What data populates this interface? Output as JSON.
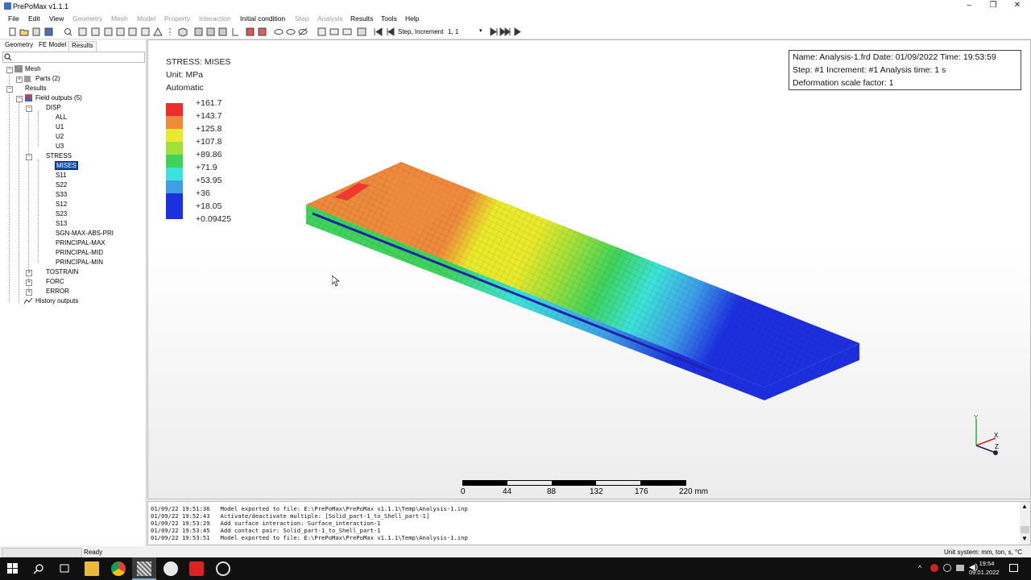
{
  "window": {
    "title": "PrePoMax v1.1.1",
    "controls": [
      "–",
      "❐",
      "✕"
    ]
  },
  "menu": [
    {
      "label": "File",
      "enabled": true
    },
    {
      "label": "Edit",
      "enabled": true
    },
    {
      "label": "View",
      "enabled": true
    },
    {
      "label": "Geometry",
      "enabled": false
    },
    {
      "label": "Mesh",
      "enabled": false
    },
    {
      "label": "Model",
      "enabled": false
    },
    {
      "label": "Property",
      "enabled": false
    },
    {
      "label": "Interaction",
      "enabled": false
    },
    {
      "label": "Initial condition",
      "enabled": true
    },
    {
      "label": "Step",
      "enabled": false
    },
    {
      "label": "Analysis",
      "enabled": false
    },
    {
      "label": "Results",
      "enabled": true
    },
    {
      "label": "Tools",
      "enabled": true
    },
    {
      "label": "Help",
      "enabled": true
    }
  ],
  "toolbar": {
    "step_increment_label": "Step, Increment",
    "step_increment_value": "1, 1"
  },
  "tabs": [
    "Geometry",
    "FE Model",
    "Results"
  ],
  "tree": {
    "mesh": "Mesh",
    "parts": "Parts (2)",
    "results": "Results",
    "field_outputs": "Field outputs (5)",
    "disp": "DISP",
    "disp_items": [
      "ALL",
      "U1",
      "U2",
      "U3"
    ],
    "stress": "STRESS",
    "stress_items": [
      "MISES",
      "S11",
      "S22",
      "S33",
      "S12",
      "S23",
      "S13",
      "SGN-MAX-ABS-PRI",
      "PRINCIPAL-MAX",
      "PRINCIPAL-MID",
      "PRINCIPAL-MIN"
    ],
    "others": [
      "TOSTRAIN",
      "FORC",
      "ERROR"
    ],
    "history_outputs": "History outputs"
  },
  "legend": {
    "title": "STRESS: MISES",
    "unit": "Unit: MPa",
    "mode": "Automatic",
    "colors": [
      "#ed2d2d",
      "#ee8a3c",
      "#eaea2c",
      "#9fe03a",
      "#3fd35c",
      "#3de3d8",
      "#3e9fe6",
      "#1d30e0"
    ],
    "values": [
      "+161.7",
      "+143.7",
      "+125.8",
      "+107.8",
      "+89.86",
      "+71.9",
      "+53.95",
      "+36",
      "+18.05",
      "+0.09425"
    ]
  },
  "info": {
    "line1": "Name: Analysis-1.frd   Date: 01/09/2022   Time: 19:53:59",
    "line2": "Step: #1   Increment: #1   Analysis time: 1 s",
    "line3": "Deformation scale factor: 1"
  },
  "scale_bar": {
    "labels": [
      "0",
      "44",
      "88",
      "132",
      "176",
      "220 mm"
    ]
  },
  "axes": {
    "y": "Y",
    "x": "X",
    "z": "Z"
  },
  "log": [
    "01/09/22 19:51:36   Model exported to file: E:\\PrePoMax\\PrePoMax v1.1.1\\Temp\\Analysis-1.inp",
    "01/09/22 19:52:43   Activate/deactivate multiple: [Solid_part-1_to_Shell_part-1]",
    "01/09/22 19:53:29   Add surface interaction: Surface_interaction-1",
    "01/09/22 19:53:45   Add contact pair: Solid_part-1_to_Shell_part-1",
    "01/09/22 19:53:51   Model exported to file: E:\\PrePoMax\\PrePoMax v1.1.1\\Temp\\Analysis-1.inp"
  ],
  "status": {
    "left": "Ready",
    "right": "Unit system: mm, ton, s, °C"
  },
  "taskbar": {
    "time": "19:54",
    "date": "09.01.2022"
  }
}
